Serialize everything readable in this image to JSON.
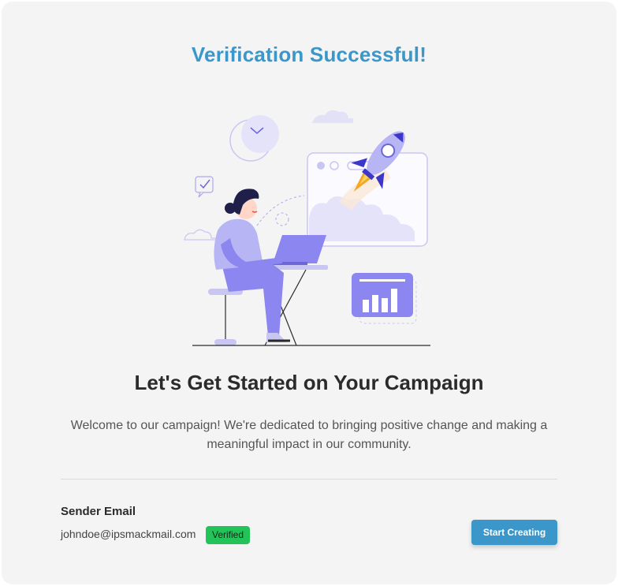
{
  "header": {
    "title": "Verification Successful!"
  },
  "main": {
    "heading": "Let's Get Started on Your Campaign",
    "description": "Welcome to our campaign! We're dedicated to bringing positive change and making a meaningful impact in our community."
  },
  "sender": {
    "label": "Sender Email",
    "email": "johndoe@ipsmackmail.com",
    "status_badge": "Verified"
  },
  "actions": {
    "start_label": "Start Creating"
  },
  "colors": {
    "accent": "#3b97c9",
    "verified": "#22c45a",
    "illustration_purple": "#8b86f0"
  }
}
